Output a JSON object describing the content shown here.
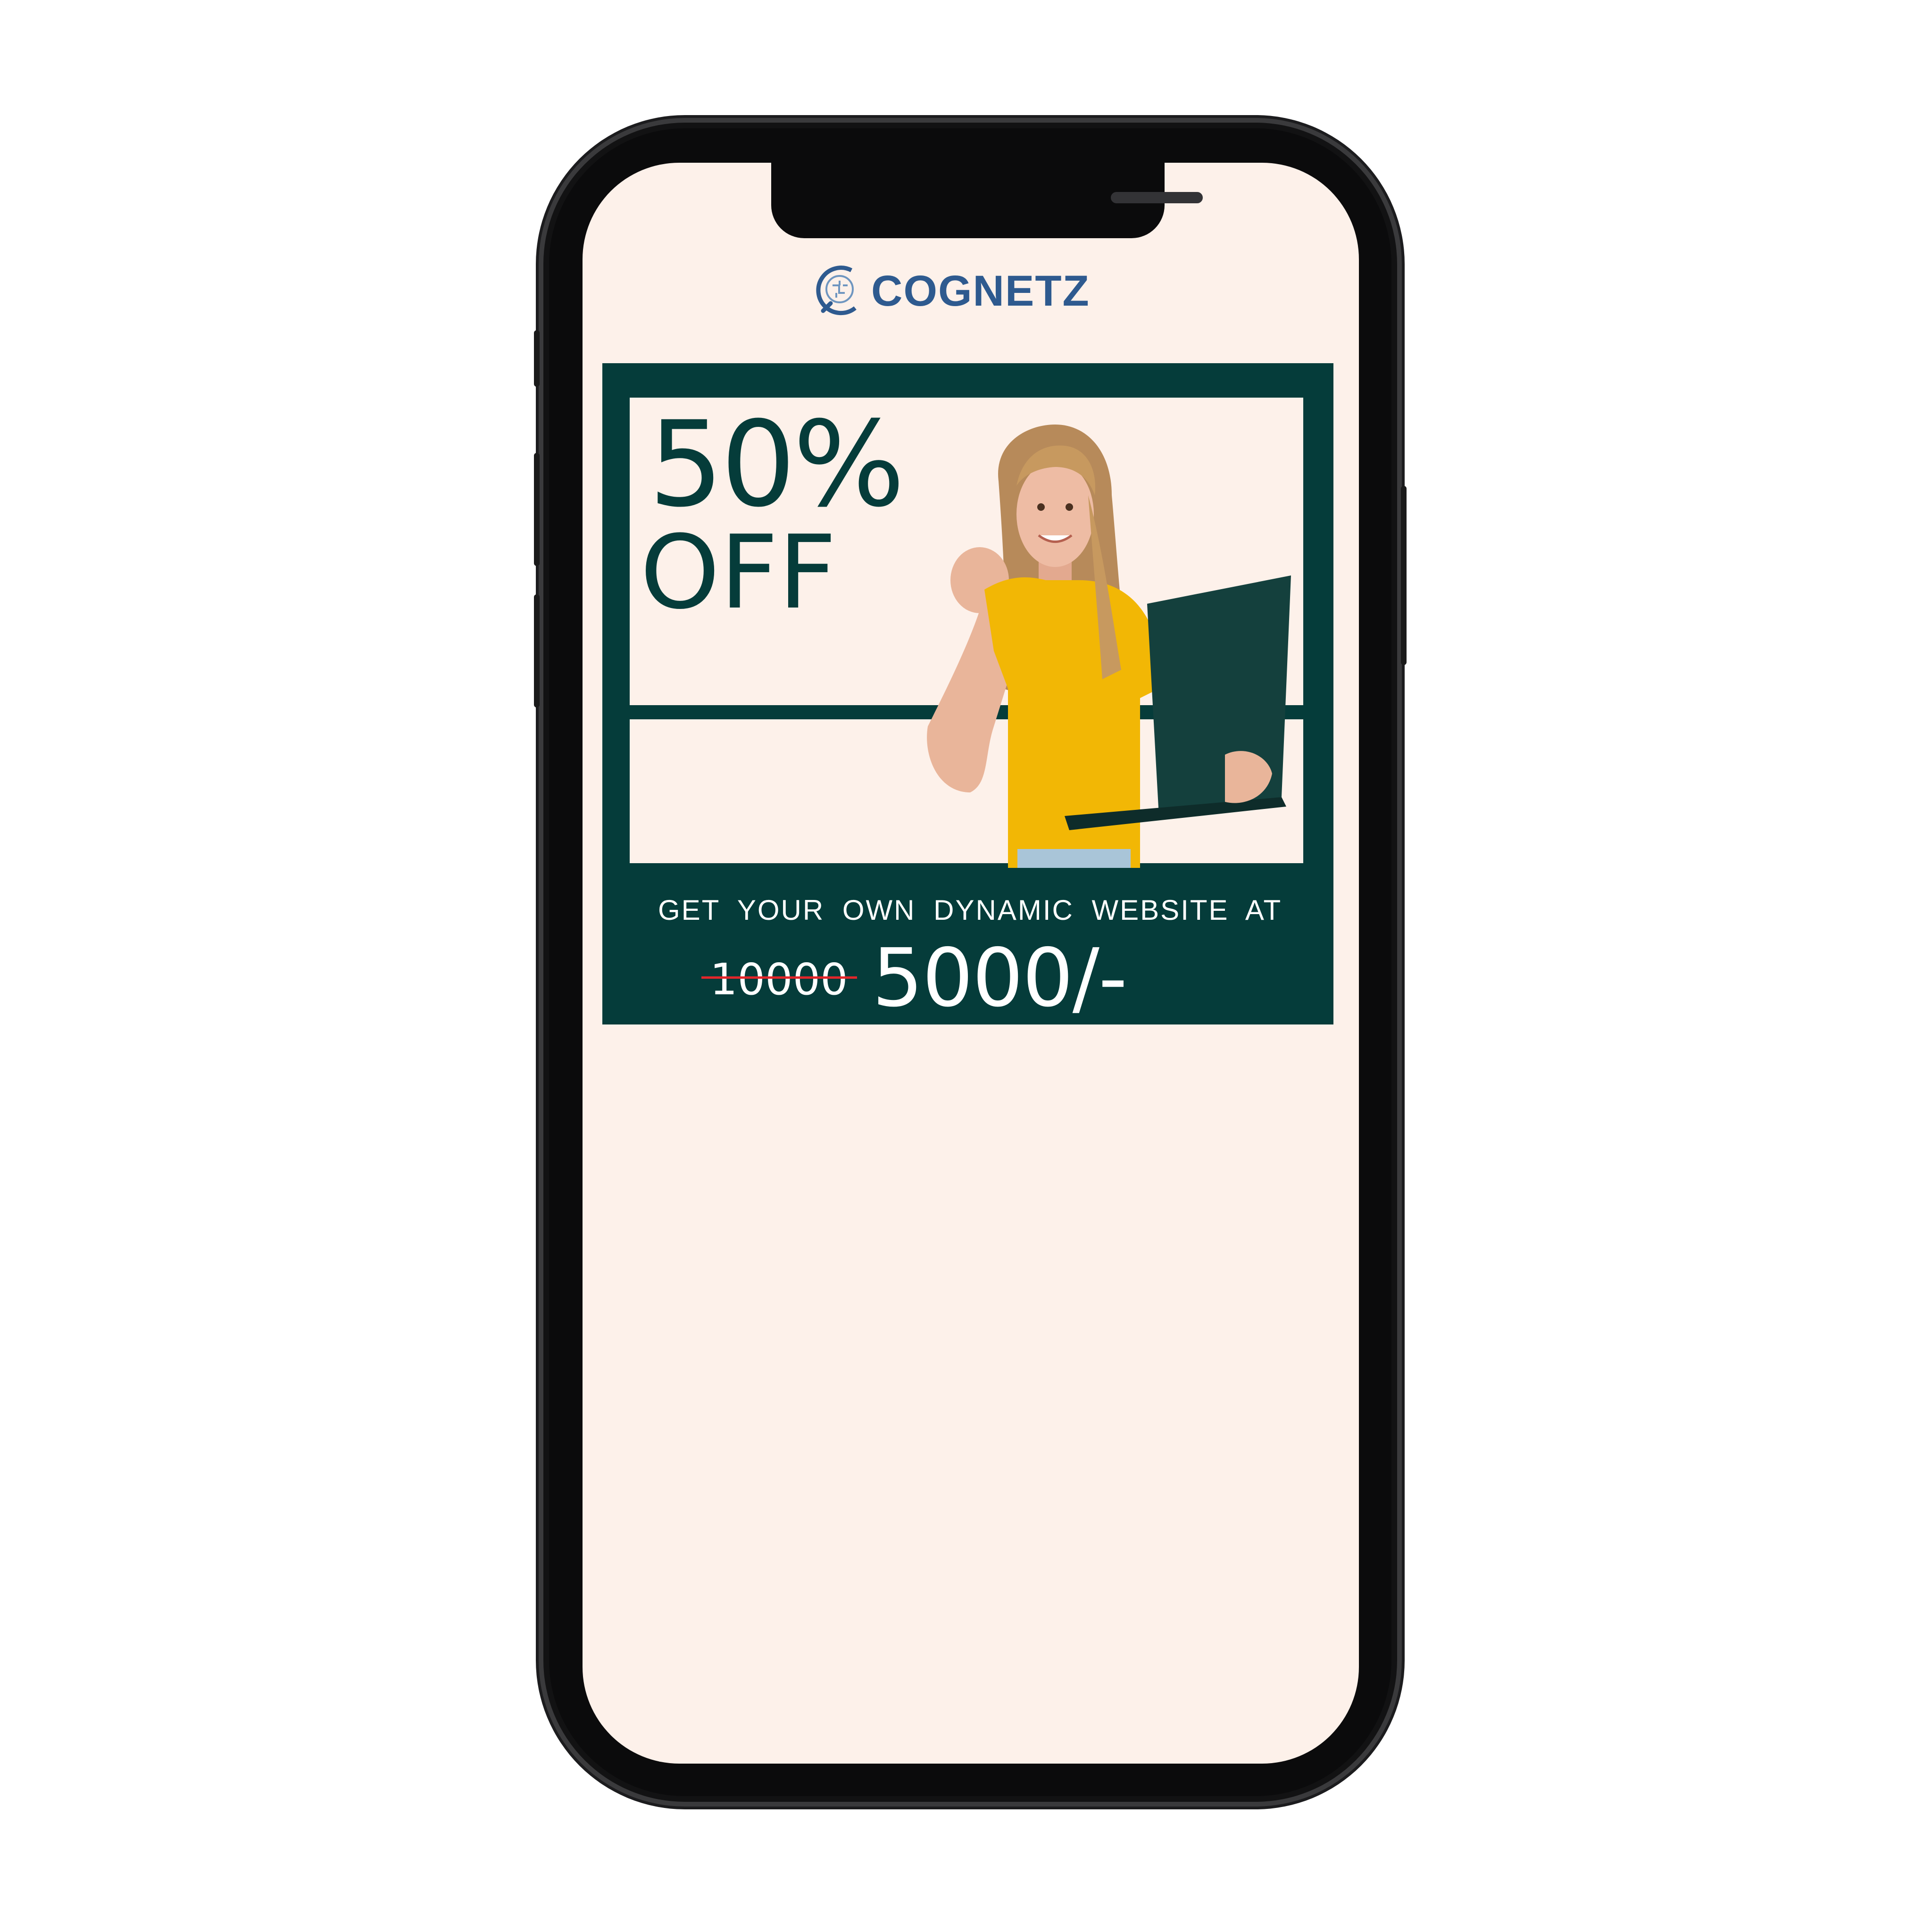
{
  "brand": {
    "name": "COGNETZ",
    "color": "#2e5a8f"
  },
  "banner": {
    "discount_pct": "50%",
    "discount_word": "OFF",
    "tagline": "GET  YOUR  OWN  DYNAMIC  WEBSITE AT",
    "old_price": "10000",
    "new_price": "5000/-"
  },
  "colors": {
    "banner_green": "#053c3a",
    "screen_bg": "#fdf1ea",
    "shirt": "#f2b705",
    "strike_red": "#e2262a"
  },
  "icons": [
    "brain-logo-icon"
  ]
}
